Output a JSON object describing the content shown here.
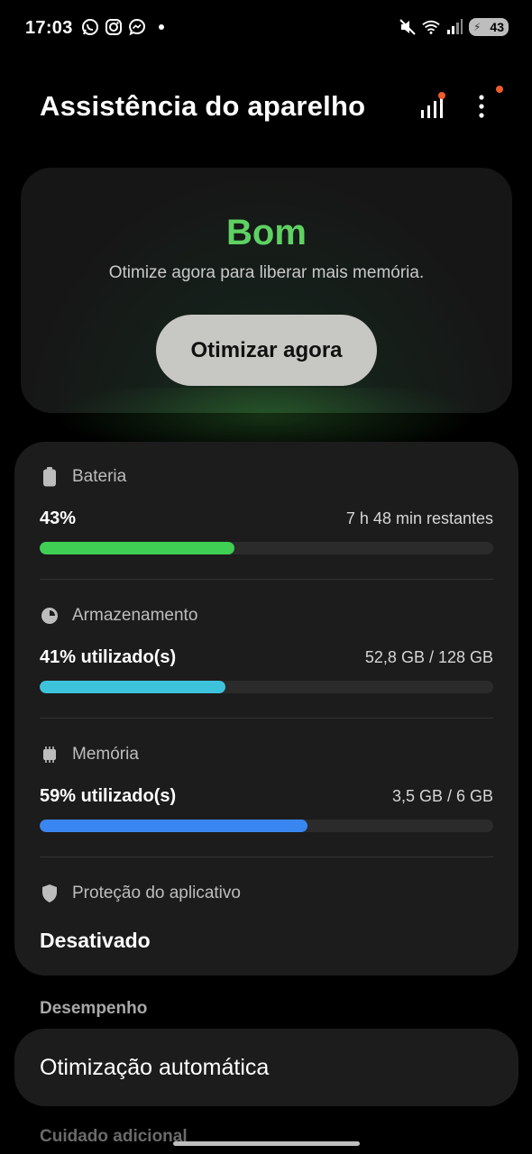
{
  "status_bar": {
    "time": "17:03",
    "battery": "43",
    "left_icons": [
      "whatsapp-icon",
      "instagram-icon",
      "messenger-icon",
      "notification-dot"
    ],
    "right_icons": [
      "mute-icon",
      "wifi-icon",
      "signal-icon",
      "battery-icon"
    ]
  },
  "header": {
    "title": "Assistência do aparelho"
  },
  "status_card": {
    "status": "Bom",
    "status_color": "#5ed162",
    "subtitle": "Otimize agora para liberar mais memória.",
    "button_label": "Otimizar agora"
  },
  "sections": {
    "battery": {
      "label": "Bateria",
      "value": "43%",
      "detail": "7 h 48 min restantes",
      "fraction": 0.43,
      "color": "#3fcf55"
    },
    "storage": {
      "label": "Armazenamento",
      "value": "41% utilizado(s)",
      "detail": "52,8 GB / 128 GB",
      "fraction": 0.41,
      "color": "#3ec3dc"
    },
    "memory": {
      "label": "Memória",
      "value": "59% utilizado(s)",
      "detail": "3,5 GB / 6 GB",
      "fraction": 0.59,
      "color": "#3a86f0"
    },
    "app_protection": {
      "label": "Proteção do aplicativo",
      "value": "Desativado"
    }
  },
  "performance": {
    "label": "Desempenho",
    "item": "Otimização automática"
  },
  "extra": {
    "label": "Cuidado adicional"
  }
}
